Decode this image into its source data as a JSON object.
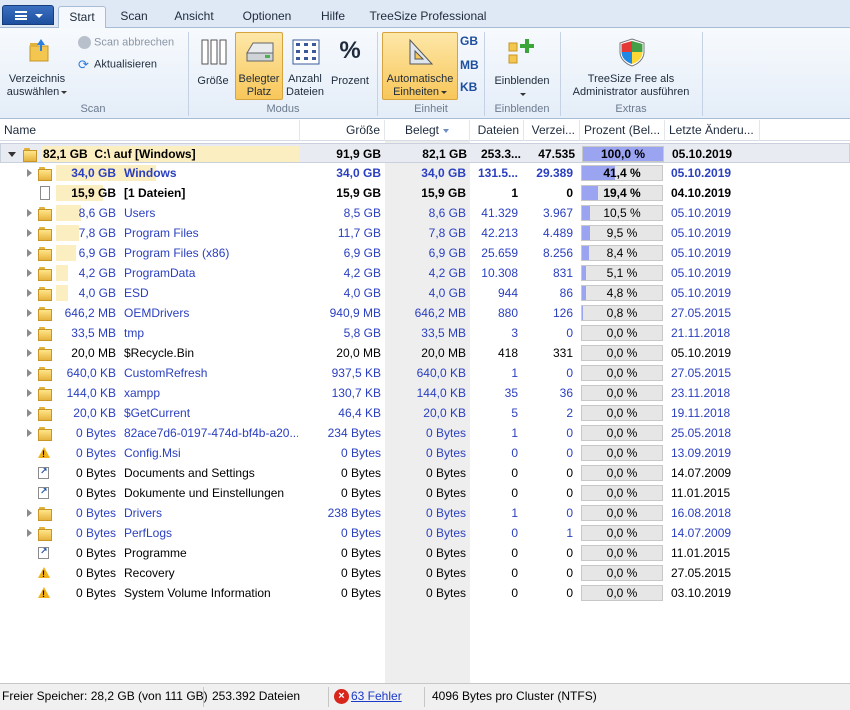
{
  "tabs": [
    {
      "label": "Start",
      "active": true
    },
    {
      "label": "Scan",
      "active": false
    },
    {
      "label": "Ansicht",
      "active": false
    },
    {
      "label": "Optionen",
      "active": false
    },
    {
      "label": "Hilfe",
      "active": false
    },
    {
      "label": "TreeSize Professional",
      "active": false
    }
  ],
  "ribbon": {
    "scan": {
      "select_dir_label_1": "Verzeichnis",
      "select_dir_label_2": "auswählen",
      "abort_label": "Scan abbrechen",
      "refresh_label": "Aktualisieren",
      "group_label": "Scan"
    },
    "modus": {
      "size_label": "Größe",
      "used_label_1": "Belegter",
      "used_label_2": "Platz",
      "count_label_1": "Anzahl",
      "count_label_2": "Dateien",
      "percent_label": "Prozent",
      "group_label": "Modus"
    },
    "einheit": {
      "auto_label_1": "Automatische",
      "auto_label_2": "Einheiten",
      "gb": "GB",
      "mb": "MB",
      "kb": "KB",
      "group_label": "Einheit"
    },
    "einblenden": {
      "show_label": "Einblenden",
      "group_label": "Einblenden"
    },
    "extras": {
      "admin_label_1": "TreeSize Free als",
      "admin_label_2": "Administrator ausführen",
      "group_label": "Extras"
    }
  },
  "columns": {
    "name": "Name",
    "size": "Größe",
    "used": "Belegt",
    "files": "Dateien",
    "dirs": "Verzei...",
    "percent": "Prozent (Bel...",
    "changed": "Letzte Änderu..."
  },
  "root": {
    "size_label": "82,1 GB",
    "name": "C:\\  auf  [Windows]",
    "size": "91,9 GB",
    "used": "82,1 GB",
    "files": "253.3...",
    "dirs": "47.535",
    "percent_text": "100,0 %",
    "percent": 100.0,
    "changed": "05.10.2019"
  },
  "rows": [
    {
      "size_label": "34,0 GB",
      "name": "Windows",
      "size": "34,0 GB",
      "used": "34,0 GB",
      "files": "131.5...",
      "dirs": "29.389",
      "percent_text": "41,4 %",
      "percent": 41.4,
      "changed": "05.10.2019",
      "icon": "folder",
      "expand": true,
      "style": "bold-blue",
      "bar": 41.4
    },
    {
      "size_label": "15,9 GB",
      "name": "[1 Dateien]",
      "size": "15,9 GB",
      "used": "15,9 GB",
      "files": "1",
      "dirs": "0",
      "percent_text": "19,4 %",
      "percent": 19.4,
      "changed": "04.10.2019",
      "icon": "file",
      "expand": false,
      "style": "bold-black",
      "bar": 19.4
    },
    {
      "size_label": "8,6 GB",
      "name": "Users",
      "size": "8,5 GB",
      "used": "8,6 GB",
      "files": "41.329",
      "dirs": "3.967",
      "percent_text": "10,5 %",
      "percent": 10.5,
      "changed": "05.10.2019",
      "icon": "folder",
      "expand": true,
      "style": "blue",
      "bar": 10.5
    },
    {
      "size_label": "7,8 GB",
      "name": "Program Files",
      "size": "11,7 GB",
      "used": "7,8 GB",
      "files": "42.213",
      "dirs": "4.489",
      "percent_text": "9,5 %",
      "percent": 9.5,
      "changed": "05.10.2019",
      "icon": "folder",
      "expand": true,
      "style": "blue",
      "bar": 9.5
    },
    {
      "size_label": "6,9 GB",
      "name": "Program Files (x86)",
      "size": "6,9 GB",
      "used": "6,9 GB",
      "files": "25.659",
      "dirs": "8.256",
      "percent_text": "8,4 %",
      "percent": 8.4,
      "changed": "05.10.2019",
      "icon": "folder",
      "expand": true,
      "style": "blue",
      "bar": 8.4
    },
    {
      "size_label": "4,2 GB",
      "name": "ProgramData",
      "size": "4,2 GB",
      "used": "4,2 GB",
      "files": "10.308",
      "dirs": "831",
      "percent_text": "5,1 %",
      "percent": 5.1,
      "changed": "05.10.2019",
      "icon": "folder",
      "expand": true,
      "style": "blue",
      "bar": 5.1
    },
    {
      "size_label": "4,0 GB",
      "name": "ESD",
      "size": "4,0 GB",
      "used": "4,0 GB",
      "files": "944",
      "dirs": "86",
      "percent_text": "4,8 %",
      "percent": 4.8,
      "changed": "05.10.2019",
      "icon": "folder",
      "expand": true,
      "style": "blue",
      "bar": 4.8
    },
    {
      "size_label": "646,2 MB",
      "name": "OEMDrivers",
      "size": "940,9 MB",
      "used": "646,2 MB",
      "files": "880",
      "dirs": "126",
      "percent_text": "0,8 %",
      "percent": 0.8,
      "changed": "27.05.2015",
      "icon": "folder",
      "expand": true,
      "style": "blue",
      "bar": 0
    },
    {
      "size_label": "33,5 MB",
      "name": "tmp",
      "size": "5,8 GB",
      "used": "33,5 MB",
      "files": "3",
      "dirs": "0",
      "percent_text": "0,0 %",
      "percent": 0.0,
      "changed": "21.11.2018",
      "icon": "folder",
      "expand": true,
      "style": "blue",
      "bar": 0
    },
    {
      "size_label": "20,0 MB",
      "name": "$Recycle.Bin",
      "size": "20,0 MB",
      "used": "20,0 MB",
      "files": "418",
      "dirs": "331",
      "percent_text": "0,0 %",
      "percent": 0.0,
      "changed": "05.10.2019",
      "icon": "folder",
      "expand": true,
      "style": "black",
      "bar": 0
    },
    {
      "size_label": "640,0 KB",
      "name": "CustomRefresh",
      "size": "937,5 KB",
      "used": "640,0 KB",
      "files": "1",
      "dirs": "0",
      "percent_text": "0,0 %",
      "percent": 0.0,
      "changed": "27.05.2015",
      "icon": "folder",
      "expand": true,
      "style": "blue",
      "bar": 0
    },
    {
      "size_label": "144,0 KB",
      "name": "xampp",
      "size": "130,7 KB",
      "used": "144,0 KB",
      "files": "35",
      "dirs": "36",
      "percent_text": "0,0 %",
      "percent": 0.0,
      "changed": "23.11.2018",
      "icon": "folder",
      "expand": true,
      "style": "blue",
      "bar": 0
    },
    {
      "size_label": "20,0 KB",
      "name": "$GetCurrent",
      "size": "46,4 KB",
      "used": "20,0 KB",
      "files": "5",
      "dirs": "2",
      "percent_text": "0,0 %",
      "percent": 0.0,
      "changed": "19.11.2018",
      "icon": "folder",
      "expand": true,
      "style": "blue",
      "bar": 0
    },
    {
      "size_label": "0 Bytes",
      "name": "82ace7d6-0197-474d-bf4b-a20...",
      "size": "234 Bytes",
      "used": "0 Bytes",
      "files": "1",
      "dirs": "0",
      "percent_text": "0,0 %",
      "percent": 0.0,
      "changed": "25.05.2018",
      "icon": "folder",
      "expand": true,
      "style": "blue",
      "bar": 0
    },
    {
      "size_label": "0 Bytes",
      "name": "Config.Msi",
      "size": "0 Bytes",
      "used": "0 Bytes",
      "files": "0",
      "dirs": "0",
      "percent_text": "0,0 %",
      "percent": 0.0,
      "changed": "13.09.2019",
      "icon": "warn",
      "expand": false,
      "style": "blue",
      "bar": 0
    },
    {
      "size_label": "0 Bytes",
      "name": "Documents and Settings",
      "size": "0 Bytes",
      "used": "0 Bytes",
      "files": "0",
      "dirs": "0",
      "percent_text": "0,0 %",
      "percent": 0.0,
      "changed": "14.07.2009",
      "icon": "link",
      "expand": false,
      "style": "black",
      "bar": 0
    },
    {
      "size_label": "0 Bytes",
      "name": "Dokumente und Einstellungen",
      "size": "0 Bytes",
      "used": "0 Bytes",
      "files": "0",
      "dirs": "0",
      "percent_text": "0,0 %",
      "percent": 0.0,
      "changed": "11.01.2015",
      "icon": "link",
      "expand": false,
      "style": "black",
      "bar": 0
    },
    {
      "size_label": "0 Bytes",
      "name": "Drivers",
      "size": "238 Bytes",
      "used": "0 Bytes",
      "files": "1",
      "dirs": "0",
      "percent_text": "0,0 %",
      "percent": 0.0,
      "changed": "16.08.2018",
      "icon": "folder",
      "expand": true,
      "style": "blue",
      "bar": 0
    },
    {
      "size_label": "0 Bytes",
      "name": "PerfLogs",
      "size": "0 Bytes",
      "used": "0 Bytes",
      "files": "0",
      "dirs": "1",
      "percent_text": "0,0 %",
      "percent": 0.0,
      "changed": "14.07.2009",
      "icon": "folder",
      "expand": true,
      "style": "blue",
      "bar": 0
    },
    {
      "size_label": "0 Bytes",
      "name": "Programme",
      "size": "0 Bytes",
      "used": "0 Bytes",
      "files": "0",
      "dirs": "0",
      "percent_text": "0,0 %",
      "percent": 0.0,
      "changed": "11.01.2015",
      "icon": "link",
      "expand": false,
      "style": "black",
      "bar": 0
    },
    {
      "size_label": "0 Bytes",
      "name": "Recovery",
      "size": "0 Bytes",
      "used": "0 Bytes",
      "files": "0",
      "dirs": "0",
      "percent_text": "0,0 %",
      "percent": 0.0,
      "changed": "27.05.2015",
      "icon": "warn",
      "expand": false,
      "style": "black",
      "bar": 0
    },
    {
      "size_label": "0 Bytes",
      "name": "System Volume Information",
      "size": "0 Bytes",
      "used": "0 Bytes",
      "files": "0",
      "dirs": "0",
      "percent_text": "0,0 %",
      "percent": 0.0,
      "changed": "03.10.2019",
      "icon": "warn",
      "expand": false,
      "style": "black",
      "bar": 0
    }
  ],
  "status": {
    "free": "Freier Speicher: 28,2 GB  (von 111 GB)",
    "files": "253.392  Dateien",
    "errors": "63 Fehler",
    "cluster": "4096  Bytes pro Cluster (NTFS)"
  },
  "colors": {
    "accent": "#2a3fbf",
    "selected_button": "#f8c75a",
    "percent_bar": "#9aa4f0",
    "size_bar": "#fbeec0"
  }
}
